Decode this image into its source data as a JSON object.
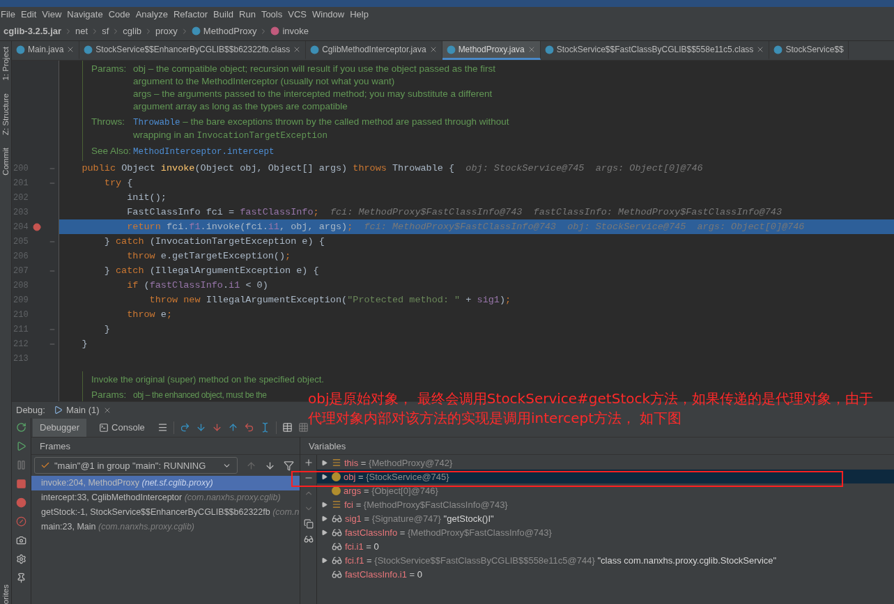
{
  "menu": [
    "File",
    "Edit",
    "View",
    "Navigate",
    "Code",
    "Analyze",
    "Refactor",
    "Build",
    "Run",
    "Tools",
    "VCS",
    "Window",
    "Help"
  ],
  "breadcrumb": [
    {
      "text": "cglib-3.2.5.jar",
      "kind": "jar"
    },
    {
      "text": "net",
      "kind": "package"
    },
    {
      "text": "sf",
      "kind": "package"
    },
    {
      "text": "cglib",
      "kind": "package"
    },
    {
      "text": "proxy",
      "kind": "package"
    },
    {
      "text": "MethodProxy",
      "kind": "class"
    },
    {
      "text": "invoke",
      "kind": "method"
    }
  ],
  "side_labels": [
    "1: Project",
    "Z: Structure",
    "Commit",
    "orites"
  ],
  "tabs": [
    {
      "label": "Main.java",
      "selected": false
    },
    {
      "label": "StockService$$EnhancerByCGLIB$$b62322fb.class",
      "selected": false
    },
    {
      "label": "CglibMethodInterceptor.java",
      "selected": false
    },
    {
      "label": "MethodProxy.java",
      "selected": true
    },
    {
      "label": "StockService$$FastClassByCGLIB$$558e11c5.class",
      "selected": false
    },
    {
      "label": "StockService$$",
      "selected": false
    }
  ],
  "doc_top": [
    {
      "label": "Params:",
      "lines": [
        [
          {
            "text": "obj – the compatible object; recursion will result if you use the object passed as the first",
            "kind": "prose"
          }
        ],
        [
          {
            "text": "argument to the MethodInterceptor (usually not what you want)",
            "kind": "prose"
          }
        ],
        [
          {
            "text": "args – the arguments passed to the intercepted method; you may substitute a different",
            "kind": "prose"
          }
        ],
        [
          {
            "text": "argument array as long as the types are compatible",
            "kind": "prose"
          }
        ]
      ]
    },
    {
      "label": "Throws:",
      "lines": [
        [
          {
            "text": "Throwable",
            "kind": "link"
          },
          {
            "text": " – the bare exceptions thrown by the called method are passed through without",
            "kind": "prose"
          }
        ],
        [
          {
            "text": "wrapping in an ",
            "kind": "prose"
          },
          {
            "text": "InvocationTargetException",
            "kind": "code"
          }
        ]
      ]
    },
    {
      "label": "See Also:",
      "lines": [
        [
          {
            "text": "MethodInterceptor.intercept",
            "kind": "link"
          }
        ]
      ]
    }
  ],
  "code": {
    "lines": [
      {
        "no": "200",
        "selected": false,
        "breakpoint": false,
        "fold": true,
        "segs": [
          {
            "text": "    public ",
            "kind": "keyword"
          },
          {
            "text": "Object ",
            "kind": "plain"
          },
          {
            "text": "invoke",
            "kind": "method"
          },
          {
            "text": "(Object obj, Object[] args) ",
            "kind": "plain"
          },
          {
            "text": "throws ",
            "kind": "keyword"
          },
          {
            "text": "Throwable {",
            "kind": "plain"
          },
          {
            "text": "  obj: StockService@745  args: Object[0]@746",
            "kind": "hint"
          }
        ]
      },
      {
        "no": "201",
        "selected": false,
        "breakpoint": false,
        "fold": true,
        "segs": [
          {
            "text": "        try",
            "kind": "keyword"
          },
          {
            "text": " {",
            "kind": "plain"
          }
        ]
      },
      {
        "no": "202",
        "selected": false,
        "breakpoint": false,
        "fold": false,
        "segs": [
          {
            "text": "            init();",
            "kind": "plain"
          }
        ]
      },
      {
        "no": "203",
        "selected": false,
        "breakpoint": false,
        "fold": false,
        "segs": [
          {
            "text": "            FastClassInfo fci = ",
            "kind": "plain"
          },
          {
            "text": "fastClassInfo",
            "kind": "field"
          },
          {
            "text": ";",
            "kind": "keyword"
          },
          {
            "text": "  fci: MethodProxy$FastClassInfo@743  fastClassInfo: MethodProxy$FastClassInfo@743",
            "kind": "hint"
          }
        ]
      },
      {
        "no": "204",
        "selected": true,
        "breakpoint": true,
        "fold": false,
        "segs": [
          {
            "text": "            return ",
            "kind": "keyword"
          },
          {
            "text": "fci.",
            "kind": "plain"
          },
          {
            "text": "f1",
            "kind": "field"
          },
          {
            "text": ".invoke(fci.",
            "kind": "plain"
          },
          {
            "text": "i1",
            "kind": "field"
          },
          {
            "text": ", obj, args)",
            "kind": "plain"
          },
          {
            "text": ";",
            "kind": "keyword"
          },
          {
            "text": "  fci: MethodProxy$FastClassInfo@743  obj: StockService@745  args: Object[0]@746",
            "kind": "hint"
          }
        ]
      },
      {
        "no": "205",
        "selected": false,
        "breakpoint": false,
        "fold": true,
        "segs": [
          {
            "text": "        } ",
            "kind": "plain"
          },
          {
            "text": "catch",
            "kind": "keyword"
          },
          {
            "text": " (InvocationTargetException e) {",
            "kind": "plain"
          }
        ]
      },
      {
        "no": "206",
        "selected": false,
        "breakpoint": false,
        "fold": false,
        "segs": [
          {
            "text": "            throw ",
            "kind": "keyword"
          },
          {
            "text": "e.getTargetException()",
            "kind": "plain"
          },
          {
            "text": ";",
            "kind": "keyword"
          }
        ]
      },
      {
        "no": "207",
        "selected": false,
        "breakpoint": false,
        "fold": true,
        "segs": [
          {
            "text": "        } ",
            "kind": "plain"
          },
          {
            "text": "catch",
            "kind": "keyword"
          },
          {
            "text": " (IllegalArgumentException e) {",
            "kind": "plain"
          }
        ]
      },
      {
        "no": "208",
        "selected": false,
        "breakpoint": false,
        "fold": false,
        "segs": [
          {
            "text": "            if ",
            "kind": "keyword"
          },
          {
            "text": "(",
            "kind": "plain"
          },
          {
            "text": "fastClassInfo",
            "kind": "field"
          },
          {
            "text": ".",
            "kind": "plain"
          },
          {
            "text": "i1",
            "kind": "field"
          },
          {
            "text": " < 0)",
            "kind": "plain"
          }
        ]
      },
      {
        "no": "209",
        "selected": false,
        "breakpoint": false,
        "fold": false,
        "segs": [
          {
            "text": "                throw new ",
            "kind": "keyword"
          },
          {
            "text": "IllegalArgumentException(",
            "kind": "plain"
          },
          {
            "text": "\"Protected method: \"",
            "kind": "string"
          },
          {
            "text": " + ",
            "kind": "plain"
          },
          {
            "text": "sig1",
            "kind": "field"
          },
          {
            "text": ")",
            "kind": "plain"
          },
          {
            "text": ";",
            "kind": "keyword"
          }
        ]
      },
      {
        "no": "210",
        "selected": false,
        "breakpoint": false,
        "fold": false,
        "segs": [
          {
            "text": "            throw ",
            "kind": "keyword"
          },
          {
            "text": "e",
            "kind": "plain"
          },
          {
            "text": ";",
            "kind": "keyword"
          }
        ]
      },
      {
        "no": "211",
        "selected": false,
        "breakpoint": false,
        "fold": true,
        "segs": [
          {
            "text": "        }",
            "kind": "plain"
          }
        ]
      },
      {
        "no": "212",
        "selected": false,
        "breakpoint": false,
        "fold": true,
        "segs": [
          {
            "text": "    }",
            "kind": "plain"
          }
        ]
      },
      {
        "no": "213",
        "selected": false,
        "breakpoint": false,
        "fold": false
      }
    ]
  },
  "doc_bottom": {
    "intro": "Invoke the original (super) method on the specified object.",
    "label": "Params:",
    "text": "obj – the enhanced object, must be the"
  },
  "debug": {
    "label": "Debug:",
    "session": "Main (1)",
    "tabs": [
      {
        "label": "Debugger",
        "selected": true
      },
      {
        "label": "Console",
        "selected": false
      }
    ]
  },
  "frames": {
    "title": "Frames",
    "thread": "\"main\"@1 in group \"main\": RUNNING",
    "items": [
      {
        "method": "invoke:204, MethodProxy",
        "pkg": "(net.sf.cglib.proxy)",
        "selected": true
      },
      {
        "method": "intercept:33, CglibMethodInterceptor",
        "pkg": "(com.nanxhs.proxy.cglib)",
        "selected": false
      },
      {
        "method": "getStock:-1, StockService$$EnhancerByCGLIB$$b62322fb",
        "pkg": "(com.n",
        "selected": false
      },
      {
        "method": "main:23, Main",
        "pkg": "(com.nanxhs.proxy.cglib)",
        "selected": false
      }
    ]
  },
  "variables": {
    "title": "Variables",
    "rows": [
      {
        "kind": "field",
        "name": "this",
        "op": "=",
        "value": "{MethodProxy@742}",
        "expandable": true,
        "selected": false
      },
      {
        "kind": "param",
        "name": "obj",
        "op": "=",
        "value": "{StockService@745}",
        "expandable": true,
        "selected": true
      },
      {
        "kind": "param",
        "name": "args",
        "op": "=",
        "value": "{Object[0]@746}",
        "expandable": false,
        "selected": false
      },
      {
        "kind": "field",
        "name": "fci",
        "op": "=",
        "value": "{MethodProxy$FastClassInfo@743}",
        "expandable": true,
        "selected": false
      },
      {
        "kind": "watch",
        "name": "sig1",
        "op": "=",
        "value": "{Signature@747}",
        "extra": "\"getStock()I\"",
        "expandable": true,
        "selected": false
      },
      {
        "kind": "watch",
        "name": "fastClassInfo",
        "op": "=",
        "value": "{MethodProxy$FastClassInfo@743}",
        "expandable": true,
        "selected": false
      },
      {
        "kind": "watch",
        "name": "fci.i1",
        "op": "=",
        "extra": "0",
        "expandable": false,
        "selected": false
      },
      {
        "kind": "watch",
        "name": "fci.f1",
        "op": "=",
        "value": "{StockService$$FastClassByCGLIB$$558e11c5@744}",
        "extra": "\"class com.nanxhs.proxy.cglib.StockService\"",
        "expandable": true,
        "selected": false
      },
      {
        "kind": "watch",
        "name": "fastClassInfo.i1",
        "op": "=",
        "extra": "0",
        "expandable": false,
        "selected": false
      }
    ]
  },
  "annotation": {
    "text": "obj是原始对象， 最终会调用StockService#getStock方法，如果传递的是代理对象，由于代理对象内部对该方法的实现是调用intercept方法， 如下图"
  }
}
